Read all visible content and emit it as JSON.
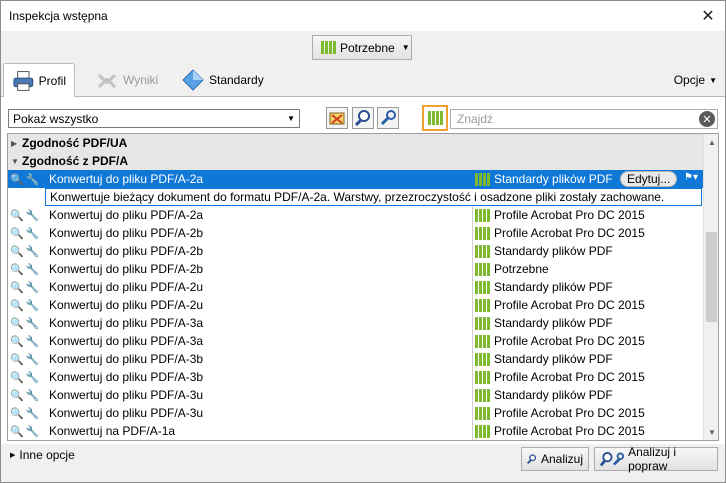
{
  "window": {
    "title": "Inspekcja wstępna",
    "close_glyph": "✕"
  },
  "filter": {
    "label": "Potrzebne"
  },
  "tabs": [
    {
      "label": "Profil",
      "icon": "printer-profile-icon"
    },
    {
      "label": "Wyniki",
      "icon": "results-icon"
    },
    {
      "label": "Standardy",
      "icon": "standards-diamond-icon"
    }
  ],
  "options_label": "Opcje",
  "toolbar": {
    "show_select": "Pokaż wszystko",
    "search_placeholder": "Znajdź"
  },
  "groups": [
    {
      "label": "Zgodność PDF/UA",
      "expanded": false
    },
    {
      "label": "Zgodność z PDF/A",
      "expanded": true
    }
  ],
  "selected": {
    "name": "Konwertuj do pliku PDF/A-2a",
    "profile": "Standardy plików PDF",
    "edit_label": "Edytuj...",
    "description": "Konwertuje bieżący dokument do formatu PDF/A-2a. Warstwy, przezroczystość i osadzone pliki zostały zachowane."
  },
  "rows": [
    {
      "name": "Konwertuj do pliku PDF/A-2a",
      "profile": "Profile Acrobat Pro DC 2015"
    },
    {
      "name": "Konwertuj do pliku PDF/A-2b",
      "profile": "Profile Acrobat Pro DC 2015"
    },
    {
      "name": "Konwertuj do pliku PDF/A-2b",
      "profile": "Standardy plików PDF"
    },
    {
      "name": "Konwertuj do pliku PDF/A-2b",
      "profile": "Potrzebne"
    },
    {
      "name": "Konwertuj do pliku PDF/A-2u",
      "profile": "Standardy plików PDF"
    },
    {
      "name": "Konwertuj do pliku PDF/A-2u",
      "profile": "Profile Acrobat Pro DC 2015"
    },
    {
      "name": "Konwertuj do pliku PDF/A-3a",
      "profile": "Standardy plików PDF"
    },
    {
      "name": "Konwertuj do pliku PDF/A-3a",
      "profile": "Profile Acrobat Pro DC 2015"
    },
    {
      "name": "Konwertuj do pliku PDF/A-3b",
      "profile": "Standardy plików PDF"
    },
    {
      "name": "Konwertuj do pliku PDF/A-3b",
      "profile": "Profile Acrobat Pro DC 2015"
    },
    {
      "name": "Konwertuj do pliku PDF/A-3u",
      "profile": "Standardy plików PDF"
    },
    {
      "name": "Konwertuj do pliku PDF/A-3u",
      "profile": "Profile Acrobat Pro DC 2015"
    },
    {
      "name": "Konwertuj na PDF/A-1a",
      "profile": "Profile Acrobat Pro DC 2015"
    }
  ],
  "bottom": {
    "more_options": "Inne opcje",
    "analyze": "Analizuj",
    "analyze_fix": "Analizuj i popraw"
  },
  "colors": {
    "selection": "#0f78d7",
    "highlight_border": "#f0a030",
    "bars_green": "#7fb92f"
  }
}
